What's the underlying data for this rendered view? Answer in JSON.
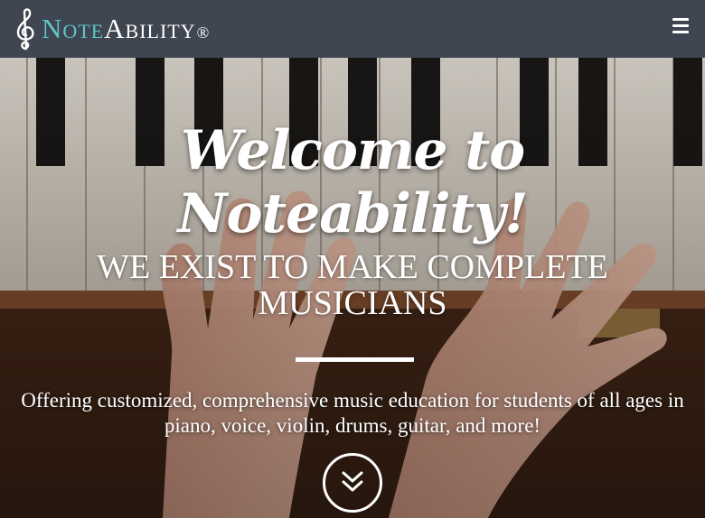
{
  "nav": {
    "brand_note": "Note",
    "brand_ability": "Ability",
    "brand_registered": "®",
    "menu_icon": "hamburger-menu-icon",
    "logo_icon": "treble-clef-icon"
  },
  "hero": {
    "title": "Welcome to Noteability!",
    "subtitle": "We Exist to Make Complete Musicians",
    "text": "Offering customized, comprehensive music education for students of all ages in piano, voice, violin, drums, guitar, and more!",
    "scroll_icon": "double-chevron-down-icon"
  },
  "colors": {
    "navbar": "#3f4551",
    "brand_accent": "#5fc7c6",
    "text": "#ffffff"
  }
}
